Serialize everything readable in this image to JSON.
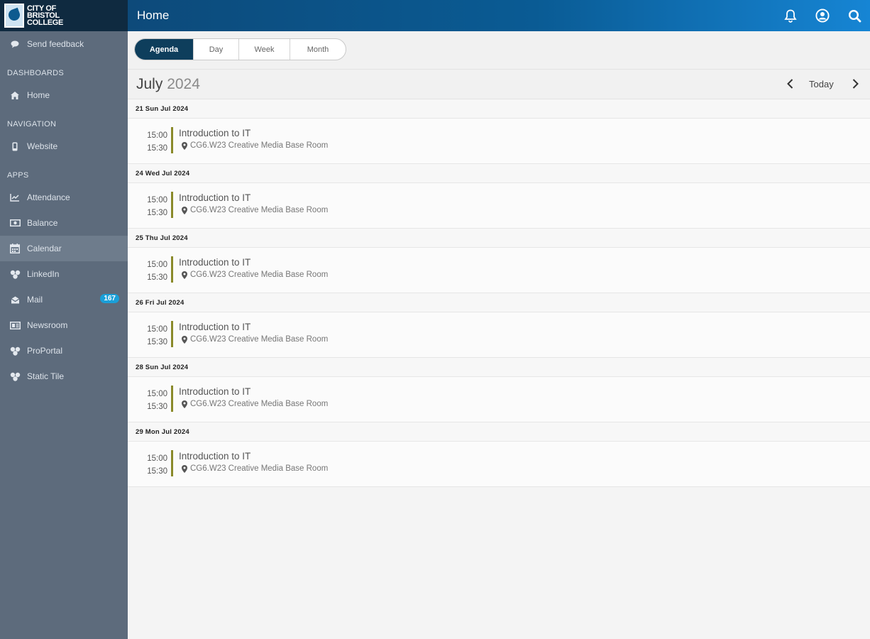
{
  "app": {
    "logo_lines": [
      "CITY OF",
      "BRISTOL",
      "COLLEGE"
    ],
    "header_title": "Home"
  },
  "sidebar": {
    "feedback_label": "Send feedback",
    "sections": {
      "dashboards": "DASHBOARDS",
      "navigation": "NAVIGATION",
      "apps": "APPS"
    },
    "home_label": "Home",
    "website_label": "Website",
    "apps": [
      {
        "label": "Attendance",
        "icon": "chart-line-icon"
      },
      {
        "label": "Balance",
        "icon": "money-icon"
      },
      {
        "label": "Calendar",
        "icon": "calendar-icon",
        "active": true
      },
      {
        "label": "LinkedIn",
        "icon": "tile-icon"
      },
      {
        "label": "Mail",
        "icon": "mail-icon",
        "badge": "167"
      },
      {
        "label": "Newsroom",
        "icon": "newspaper-icon"
      },
      {
        "label": "ProPortal",
        "icon": "tile-icon"
      },
      {
        "label": "Static Tile",
        "icon": "tile-icon"
      }
    ]
  },
  "tabs": {
    "agenda": "Agenda",
    "day": "Day",
    "week": "Week",
    "month": "Month"
  },
  "calendar": {
    "month": "July",
    "year": "2024",
    "today_label": "Today"
  },
  "agenda": [
    {
      "day": "21 Sun Jul 2024",
      "start": "15:00",
      "end": "15:30",
      "title": "Introduction to IT",
      "location": "CG6.W23 Creative Media Base Room"
    },
    {
      "day": "24 Wed Jul 2024",
      "start": "15:00",
      "end": "15:30",
      "title": "Introduction to IT",
      "location": "CG6.W23 Creative Media Base Room"
    },
    {
      "day": "25 Thu Jul 2024",
      "start": "15:00",
      "end": "15:30",
      "title": "Introduction to IT",
      "location": "CG6.W23 Creative Media Base Room"
    },
    {
      "day": "26 Fri Jul 2024",
      "start": "15:00",
      "end": "15:30",
      "title": "Introduction to IT",
      "location": "CG6.W23 Creative Media Base Room"
    },
    {
      "day": "28 Sun Jul 2024",
      "start": "15:00",
      "end": "15:30",
      "title": "Introduction to IT",
      "location": "CG6.W23 Creative Media Base Room"
    },
    {
      "day": "29 Mon Jul 2024",
      "start": "15:00",
      "end": "15:30",
      "title": "Introduction to IT",
      "location": "CG6.W23 Creative Media Base Room"
    }
  ],
  "colors": {
    "header_start": "#0d4a7a",
    "header_end": "#1685d4",
    "sidebar": "#5d6b7c",
    "active_tab": "#0e3e5c",
    "event_bar": "#8a8a2a",
    "badge": "#1a9fd8"
  }
}
